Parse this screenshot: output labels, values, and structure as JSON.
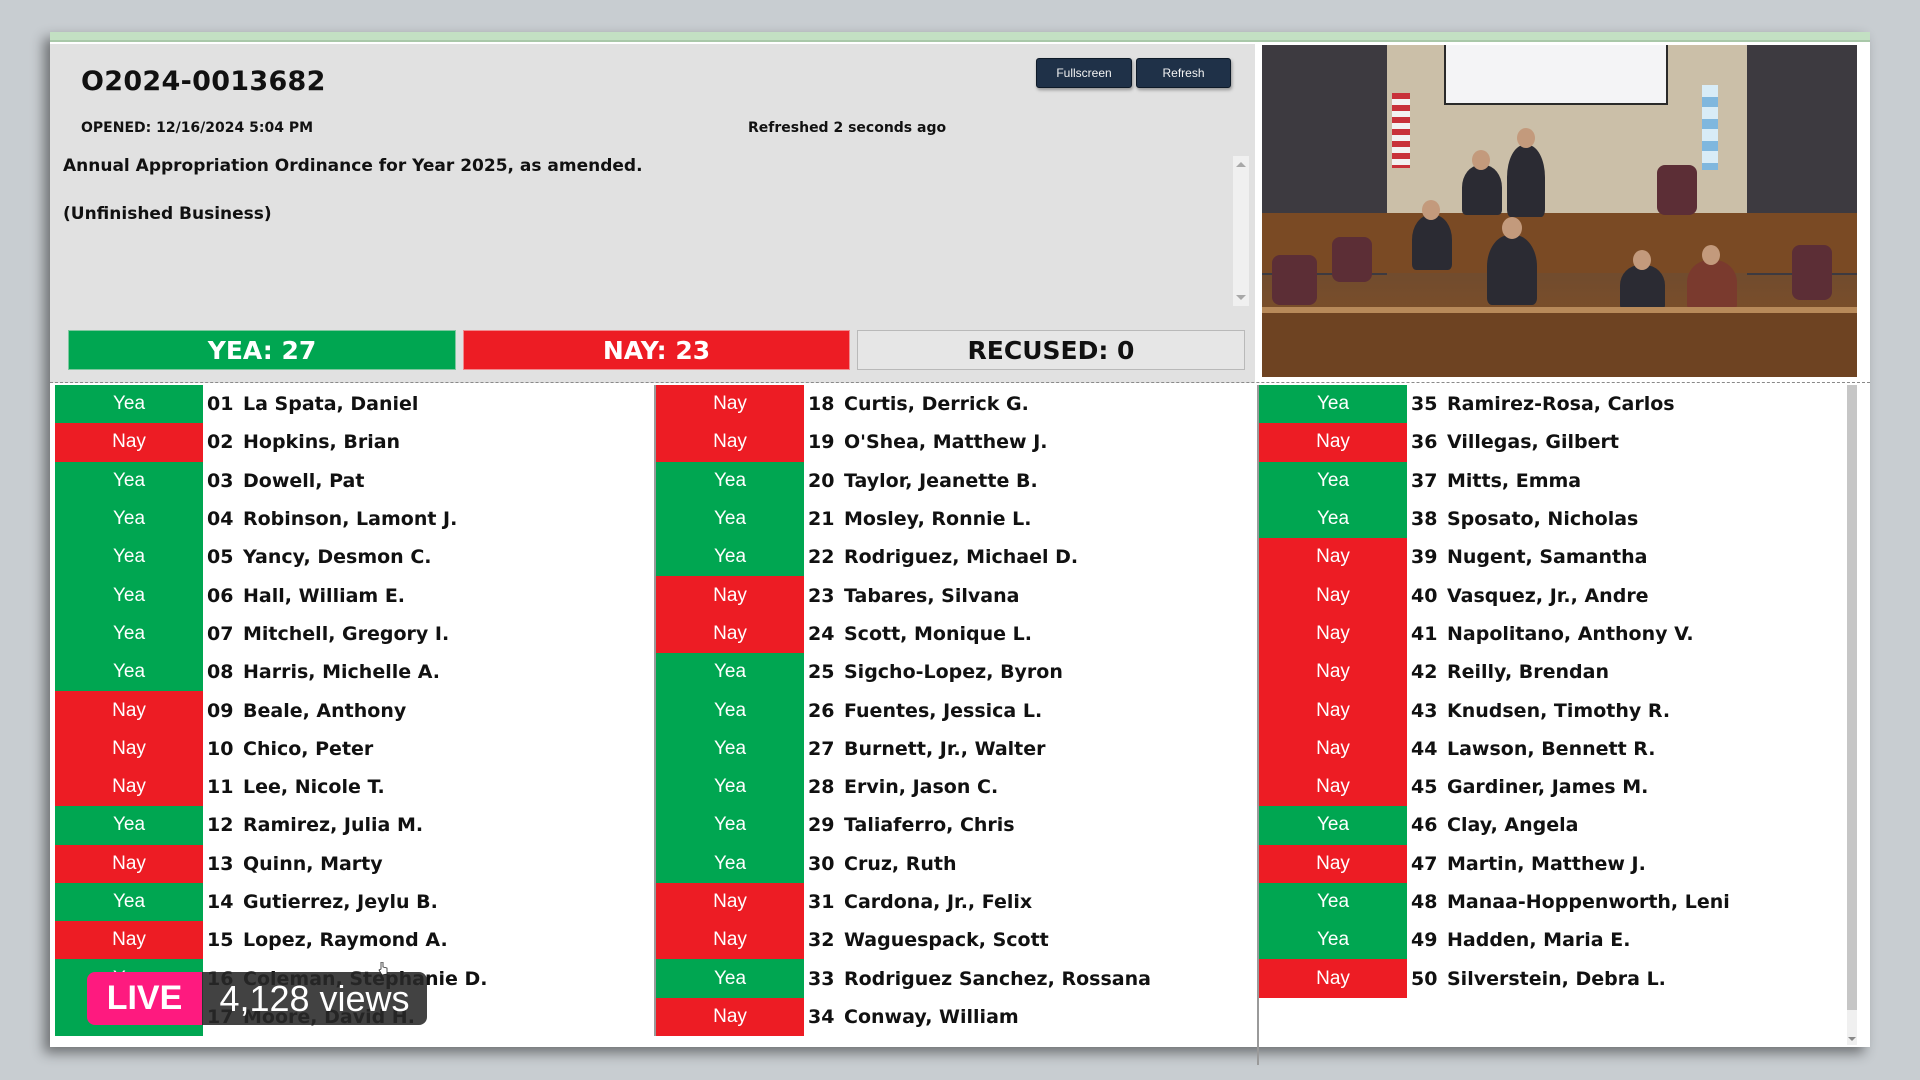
{
  "record": {
    "id": "O2024-0013682",
    "opened": "OPENED: 12/16/2024 5:04 PM",
    "refreshed": "Refreshed 2 seconds ago",
    "description": "Annual Appropriation Ordinance for Year 2025, as amended.",
    "note": "(Unfinished Business)"
  },
  "toolbar": {
    "fullscreen_label": "Fullscreen",
    "refresh_label": "Refresh"
  },
  "tally": {
    "yea": "YEA: 27",
    "nay": "NAY: 23",
    "recused": "RECUSED: 0"
  },
  "colors": {
    "yea": "#00a651",
    "nay": "#ed1c24",
    "live": "#fe1a7f"
  },
  "video": {
    "description": "Live video feed of the city council chamber"
  },
  "overlay": {
    "live_label": "LIVE",
    "views": "4,128 views"
  },
  "votes": [
    {
      "num": "01",
      "name": "La Spata, Daniel",
      "vote": "Yea"
    },
    {
      "num": "02",
      "name": "Hopkins, Brian",
      "vote": "Nay"
    },
    {
      "num": "03",
      "name": "Dowell, Pat",
      "vote": "Yea"
    },
    {
      "num": "04",
      "name": "Robinson, Lamont J.",
      "vote": "Yea"
    },
    {
      "num": "05",
      "name": "Yancy, Desmon C.",
      "vote": "Yea"
    },
    {
      "num": "06",
      "name": "Hall, William E.",
      "vote": "Yea"
    },
    {
      "num": "07",
      "name": "Mitchell, Gregory I.",
      "vote": "Yea"
    },
    {
      "num": "08",
      "name": "Harris, Michelle A.",
      "vote": "Yea"
    },
    {
      "num": "09",
      "name": "Beale, Anthony",
      "vote": "Nay"
    },
    {
      "num": "10",
      "name": "Chico, Peter",
      "vote": "Nay"
    },
    {
      "num": "11",
      "name": "Lee, Nicole T.",
      "vote": "Nay"
    },
    {
      "num": "12",
      "name": "Ramirez, Julia M.",
      "vote": "Yea"
    },
    {
      "num": "13",
      "name": "Quinn, Marty",
      "vote": "Nay"
    },
    {
      "num": "14",
      "name": "Gutierrez, Jeylu B.",
      "vote": "Yea"
    },
    {
      "num": "15",
      "name": "Lopez, Raymond A.",
      "vote": "Nay"
    },
    {
      "num": "16",
      "name": "Coleman, Stephanie D.",
      "vote": "Yea"
    },
    {
      "num": "17",
      "name": "Moore, David H.",
      "vote": "Yea"
    },
    {
      "num": "18",
      "name": "Curtis, Derrick G.",
      "vote": "Nay"
    },
    {
      "num": "19",
      "name": "O'Shea, Matthew J.",
      "vote": "Nay"
    },
    {
      "num": "20",
      "name": "Taylor, Jeanette B.",
      "vote": "Yea"
    },
    {
      "num": "21",
      "name": "Mosley, Ronnie L.",
      "vote": "Yea"
    },
    {
      "num": "22",
      "name": "Rodriguez, Michael D.",
      "vote": "Yea"
    },
    {
      "num": "23",
      "name": "Tabares, Silvana",
      "vote": "Nay"
    },
    {
      "num": "24",
      "name": "Scott, Monique L.",
      "vote": "Nay"
    },
    {
      "num": "25",
      "name": "Sigcho-Lopez, Byron",
      "vote": "Yea"
    },
    {
      "num": "26",
      "name": "Fuentes, Jessica L.",
      "vote": "Yea"
    },
    {
      "num": "27",
      "name": "Burnett, Jr., Walter",
      "vote": "Yea"
    },
    {
      "num": "28",
      "name": "Ervin, Jason C.",
      "vote": "Yea"
    },
    {
      "num": "29",
      "name": "Taliaferro, Chris",
      "vote": "Yea"
    },
    {
      "num": "30",
      "name": "Cruz, Ruth",
      "vote": "Yea"
    },
    {
      "num": "31",
      "name": "Cardona, Jr., Felix",
      "vote": "Nay"
    },
    {
      "num": "32",
      "name": "Waguespack, Scott",
      "vote": "Nay"
    },
    {
      "num": "33",
      "name": "Rodriguez Sanchez, Rossana",
      "vote": "Yea"
    },
    {
      "num": "34",
      "name": "Conway, William",
      "vote": "Nay"
    },
    {
      "num": "35",
      "name": "Ramirez-Rosa, Carlos",
      "vote": "Yea"
    },
    {
      "num": "36",
      "name": "Villegas, Gilbert",
      "vote": "Nay"
    },
    {
      "num": "37",
      "name": "Mitts, Emma",
      "vote": "Yea"
    },
    {
      "num": "38",
      "name": "Sposato, Nicholas",
      "vote": "Yea"
    },
    {
      "num": "39",
      "name": "Nugent, Samantha",
      "vote": "Nay"
    },
    {
      "num": "40",
      "name": "Vasquez, Jr., Andre",
      "vote": "Nay"
    },
    {
      "num": "41",
      "name": "Napolitano, Anthony V.",
      "vote": "Nay"
    },
    {
      "num": "42",
      "name": "Reilly, Brendan",
      "vote": "Nay"
    },
    {
      "num": "43",
      "name": "Knudsen, Timothy R.",
      "vote": "Nay"
    },
    {
      "num": "44",
      "name": "Lawson, Bennett R.",
      "vote": "Nay"
    },
    {
      "num": "45",
      "name": "Gardiner, James M.",
      "vote": "Nay"
    },
    {
      "num": "46",
      "name": "Clay, Angela",
      "vote": "Yea"
    },
    {
      "num": "47",
      "name": "Martin, Matthew J.",
      "vote": "Nay"
    },
    {
      "num": "48",
      "name": "Manaa-Hoppenworth, Leni",
      "vote": "Yea"
    },
    {
      "num": "49",
      "name": "Hadden, Maria E.",
      "vote": "Yea"
    },
    {
      "num": "50",
      "name": "Silverstein, Debra L.",
      "vote": "Nay"
    }
  ]
}
